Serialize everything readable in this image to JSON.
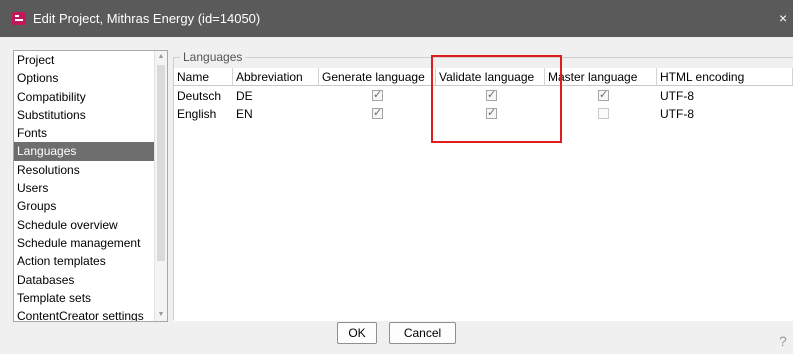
{
  "window": {
    "title": "Edit Project, Mithras Energy (id=14050)",
    "close_glyph": "×"
  },
  "sidebar": {
    "items": [
      {
        "label": "Project"
      },
      {
        "label": "Options"
      },
      {
        "label": "Compatibility"
      },
      {
        "label": "Substitutions"
      },
      {
        "label": "Fonts"
      },
      {
        "label": "Languages",
        "selected": true
      },
      {
        "label": "Resolutions"
      },
      {
        "label": "Users"
      },
      {
        "label": "Groups"
      },
      {
        "label": "Schedule overview"
      },
      {
        "label": "Schedule management"
      },
      {
        "label": "Action templates"
      },
      {
        "label": "Databases"
      },
      {
        "label": "Template sets"
      },
      {
        "label": "ContentCreator settings"
      }
    ]
  },
  "languages": {
    "legend": "Languages",
    "columns": [
      "Name",
      "Abbreviation",
      "Generate language",
      "Validate language",
      "Master language",
      "HTML encoding"
    ],
    "rows": [
      {
        "name": "Deutsch",
        "abbreviation": "DE",
        "generate": true,
        "validate": true,
        "master": true,
        "encoding": "UTF-8"
      },
      {
        "name": "English",
        "abbreviation": "EN",
        "generate": true,
        "validate": true,
        "master": false,
        "encoding": "UTF-8"
      }
    ]
  },
  "buttons": {
    "ok": "OK",
    "cancel": "Cancel"
  },
  "help_glyph": "?",
  "colors": {
    "titlebar": "#5a5a5a",
    "selection": "#6e6e6e",
    "highlight": "#e01c1c",
    "app_icon": "#c2185b"
  }
}
